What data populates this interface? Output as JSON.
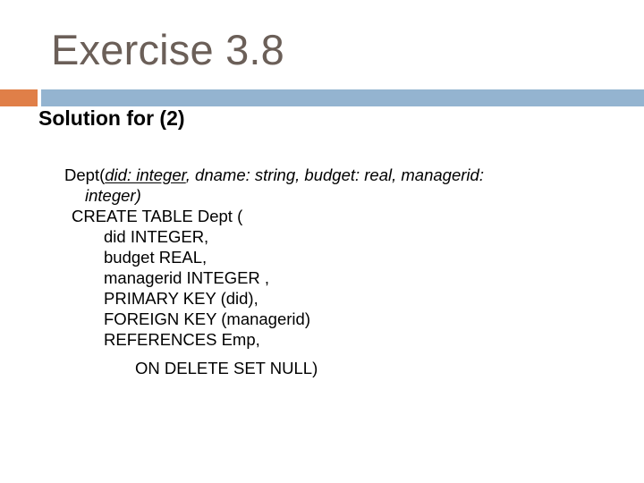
{
  "slide": {
    "title": "Exercise 3.8",
    "subtitle": "Solution for (2)",
    "colors": {
      "title": "#6b5f58",
      "accent_orange": "#e07f48",
      "accent_blue": "#94b4d0"
    },
    "schema": {
      "prefix": "Dept(",
      "key_part": "did: integer",
      "rest_line1": ", dname: string, budget: real, managerid:",
      "line2": "integer)"
    },
    "sql": [
      "CREATE TABLE Dept (",
      "did INTEGER,",
      "budget REAL,",
      "managerid INTEGER ,",
      "PRIMARY KEY (did),",
      "FOREIGN KEY (managerid)",
      "REFERENCES Emp,",
      "ON DELETE SET NULL)"
    ]
  }
}
